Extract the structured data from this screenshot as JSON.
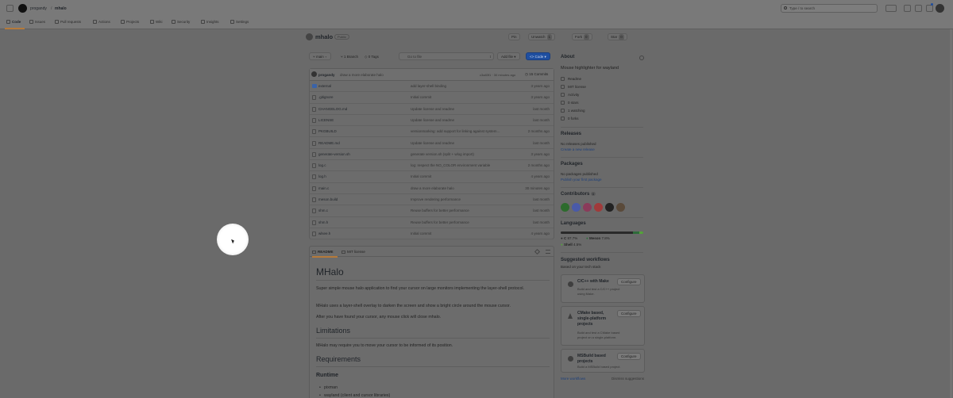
{
  "header": {
    "owner": "progandy",
    "separator": "/",
    "repo": "mhalo",
    "search_placeholder": "Type / to search"
  },
  "nav": {
    "items": [
      "Code",
      "Issues",
      "Pull requests",
      "Actions",
      "Projects",
      "Wiki",
      "Security",
      "Insights",
      "Settings"
    ]
  },
  "repo": {
    "name": "mhalo",
    "visibility": "Public",
    "pin": "Pin",
    "unwatch": "Unwatch",
    "watch_count": "1",
    "fork": "Fork",
    "fork_count": "0",
    "star": "Star",
    "star_count": "0"
  },
  "branchbar": {
    "branch": "main",
    "branches": "1 Branch",
    "tags": "0 Tags",
    "goto": "Go to file",
    "goto_key": "t",
    "add_file": "Add file",
    "code": "Code"
  },
  "commit": {
    "user": "progandy",
    "message": "draw a more elaborate halo",
    "hash": "c3a83f1 · 30 minutes ago",
    "commits": "15 Commits"
  },
  "files": [
    {
      "name": "external",
      "msg": "add layer-shell binding",
      "age": "3 years ago",
      "type": "folder"
    },
    {
      "name": ".gitignore",
      "msg": "Initial commit",
      "age": "3 years ago",
      "type": "file"
    },
    {
      "name": "CHANGELOG.md",
      "msg": "Update license and readme",
      "age": "last month",
      "type": "file"
    },
    {
      "name": "LICENSE",
      "msg": "Update license and readme",
      "age": "last month",
      "type": "file"
    },
    {
      "name": "PKGBUILD",
      "msg": "versionmarking: add support for linking against system...",
      "age": "2 months ago",
      "type": "file"
    },
    {
      "name": "README.md",
      "msg": "Update license and readme",
      "age": "last month",
      "type": "file"
    },
    {
      "name": "generate-version.sh",
      "msg": "generate version.sh (split + wlog import)",
      "age": "3 years ago",
      "type": "file"
    },
    {
      "name": "log.c",
      "msg": "log: respect the NO_COLOR environment variable",
      "age": "2 months ago",
      "type": "file"
    },
    {
      "name": "log.h",
      "msg": "Initial commit",
      "age": "4 years ago",
      "type": "file"
    },
    {
      "name": "main.c",
      "msg": "draw a more elaborate halo",
      "age": "30 minutes ago",
      "type": "file"
    },
    {
      "name": "meson.build",
      "msg": "Improve rendering performance",
      "age": "last month",
      "type": "file"
    },
    {
      "name": "shm.c",
      "msg": "Reuse buffers for better performance",
      "age": "last month",
      "type": "file"
    },
    {
      "name": "shm.h",
      "msg": "Reuse buffers for better performance",
      "age": "last month",
      "type": "file"
    },
    {
      "name": "wlsee.h",
      "msg": "Initial commit",
      "age": "4 years ago",
      "type": "file"
    }
  ],
  "readme": {
    "tab_readme": "README",
    "tab_license": "MIT license",
    "h1": "MHalo",
    "p1": "Super simple mouse halo application to find your cursor on large monitors implementing the layer-shell protocol.",
    "p2": "MHalo uses a layer-shell overlay to darken the screen and show a bright circle around the mouse cursor.",
    "p3": "After you have found your cursor, any mouse click will close mhalo.",
    "h2_limitations": "Limitations",
    "p4": "MHalo may require you to move your cursor to be informed of its position.",
    "h2_requirements": "Requirements",
    "h3_runtime": "Runtime",
    "li1": "pixman",
    "li2": "wayland (client and cursor libraries)"
  },
  "about": {
    "title": "About",
    "desc": "Mouse highlighter for wayland",
    "readme": "Readme",
    "license": "MIT license",
    "activity": "Activity",
    "stars": "0 stars",
    "watching": "1 watching",
    "forks": "0 forks"
  },
  "releases": {
    "title": "Releases",
    "none": "No releases published",
    "create": "Create a new release"
  },
  "packages": {
    "title": "Packages",
    "none": "No packages published",
    "publish": "Publish your first package"
  },
  "contributors": {
    "title": "Contributors",
    "count": "6"
  },
  "languages": {
    "title": "Languages",
    "items": [
      {
        "name": "C",
        "pct": "87.7%",
        "fraction": 0.877,
        "color": "#2a2a2a"
      },
      {
        "name": "Meson",
        "pct": "7.8%",
        "fraction": 0.078,
        "color": "#2e6b3a"
      },
      {
        "name": "Shell",
        "pct": "4.5%",
        "fraction": 0.045,
        "color": "#54a33a"
      }
    ]
  },
  "workflows": {
    "title": "Suggested workflows",
    "subtitle": "Based on your tech stack",
    "items": [
      {
        "title": "C/C++ with Make",
        "desc": "Build and test a C/C++ project using Make.",
        "btn": "Configure"
      },
      {
        "title": "CMake based, single-platform projects",
        "desc": "Build and test a CMake based project on a single-platform.",
        "btn": "Configure"
      },
      {
        "title": "MSBuild based projects",
        "desc": "Build a MSBuild based project.",
        "btn": "Configure"
      }
    ],
    "more": "More workflows",
    "dismiss": "Dismiss suggestions"
  }
}
